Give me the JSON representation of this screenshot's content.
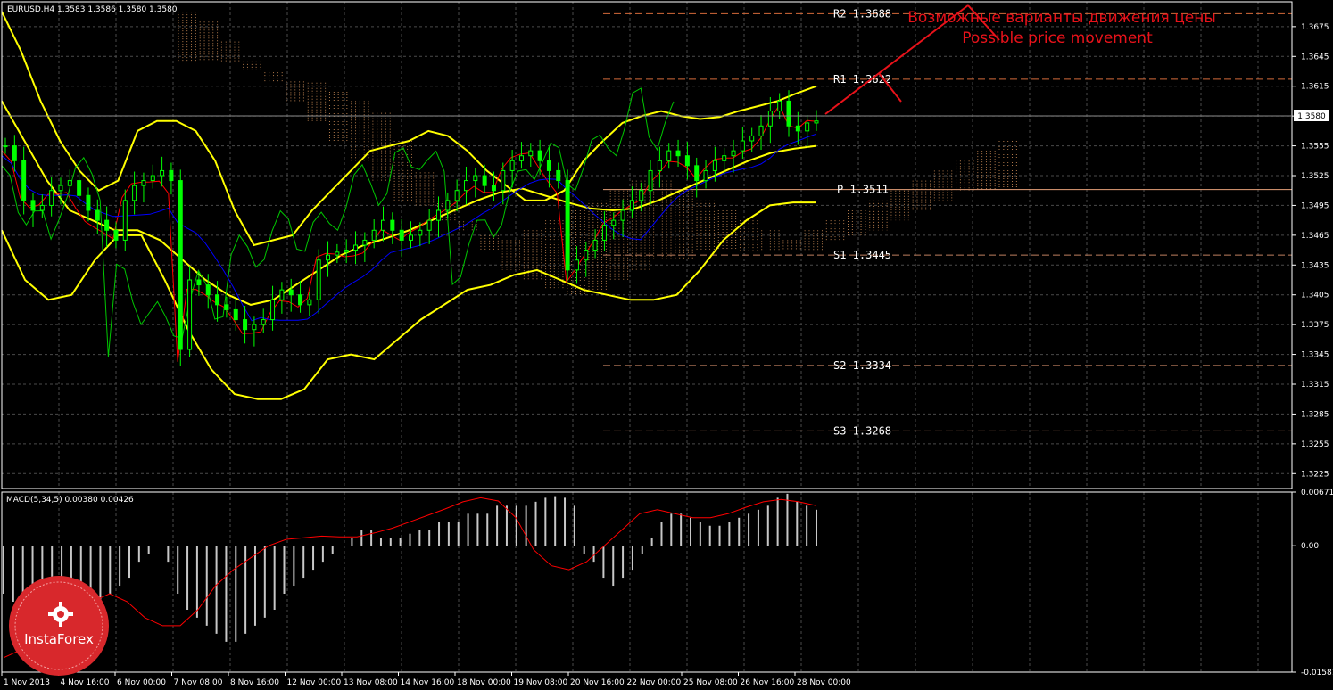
{
  "header": {
    "symbol_line": "EURUSD,H4  1.3583 1.3586 1.3580 1.3580",
    "macd_line": "MACD(5,34,5) 0.00380 0.00426"
  },
  "annotation": {
    "line_ru": "Возможные варианты движения цены",
    "line_en": "Possible price movement"
  },
  "current_price": "1.3580",
  "logo": {
    "text": "InstaForex"
  },
  "colors": {
    "background": "#000000",
    "grid": "#4a4a4a",
    "axis": "#ffffff",
    "candle": "#00ff00",
    "bollinger": "#ffff00",
    "tenkan": "#ff0000",
    "kijun": "#0000ff",
    "chikou": "#00c800",
    "cloud": "#d2915a",
    "pivot_resistance": "#d46a3a",
    "pivot_line": "#e6a07a",
    "support": "#c08060",
    "macd_hist": "#c8c8c8",
    "macd_signal": "#ff0000",
    "annotation": "#e8121a",
    "logo": "#d8282c"
  },
  "chart_data": [
    {
      "type": "candlestick",
      "title": "EURUSD,H4",
      "ylim": [
        1.321,
        1.37
      ],
      "y_ticks": [
        "1.3675",
        "1.3645",
        "1.3615",
        "1.3585",
        "1.3555",
        "1.3525",
        "1.3495",
        "1.3465",
        "1.3435",
        "1.3405",
        "1.3375",
        "1.3345",
        "1.3315",
        "1.3285",
        "1.3255",
        "1.3225"
      ],
      "x_ticks": [
        "1 Nov 2013",
        "4 Nov 16:00",
        "6 Nov 00:00",
        "7 Nov 08:00",
        "8 Nov 16:00",
        "12 Nov 00:00",
        "13 Nov 08:00",
        "14 Nov 16:00",
        "18 Nov 00:00",
        "19 Nov 08:00",
        "20 Nov 16:00",
        "22 Nov 00:00",
        "25 Nov 08:00",
        "26 Nov 16:00",
        "28 Nov 00:00"
      ],
      "levels": [
        {
          "name": "R2",
          "label": "R2  1.3688",
          "value": 1.3688
        },
        {
          "name": "R1",
          "label": "R1  1.3622",
          "value": 1.3622
        },
        {
          "name": "P",
          "label": "P  1.3511",
          "value": 1.3511
        },
        {
          "name": "S1",
          "label": "S1  1.3445",
          "value": 1.3445
        },
        {
          "name": "S2",
          "label": "S2  1.3334",
          "value": 1.3334
        },
        {
          "name": "S3",
          "label": "S3  1.3268",
          "value": 1.3268
        }
      ],
      "close_path": [
        1.3555,
        1.354,
        1.35,
        1.349,
        1.3495,
        1.351,
        1.3515,
        1.352,
        1.3505,
        1.349,
        1.348,
        1.347,
        1.346,
        1.35,
        1.3515,
        1.352,
        1.3525,
        1.353,
        1.352,
        1.335,
        1.342,
        1.3415,
        1.3405,
        1.3395,
        1.339,
        1.338,
        1.337,
        1.3375,
        1.338,
        1.34,
        1.341,
        1.3405,
        1.3395,
        1.34,
        1.344,
        1.3445,
        1.3448,
        1.345,
        1.3455,
        1.346,
        1.347,
        1.348,
        1.347,
        1.346,
        1.3465,
        1.347,
        1.348,
        1.349,
        1.35,
        1.351,
        1.352,
        1.3525,
        1.3515,
        1.351,
        1.353,
        1.354,
        1.3545,
        1.355,
        1.354,
        1.353,
        1.352,
        1.343,
        1.344,
        1.345,
        1.346,
        1.3475,
        1.348,
        1.349,
        1.35,
        1.351,
        1.353,
        1.354,
        1.355,
        1.3545,
        1.3535,
        1.352,
        1.353,
        1.354,
        1.3545,
        1.355,
        1.356,
        1.3565,
        1.3575,
        1.359,
        1.36,
        1.3575,
        1.357,
        1.3578,
        1.358
      ],
      "bollinger_upper": [
        1.369,
        1.365,
        1.36,
        1.356,
        1.353,
        1.351,
        1.352,
        1.357,
        1.358,
        1.358,
        1.357,
        1.354,
        1.349,
        1.3455,
        1.346,
        1.3465,
        1.349,
        1.351,
        1.353,
        1.355,
        1.3555,
        1.356,
        1.357,
        1.3565,
        1.355,
        1.353,
        1.3515,
        1.35,
        1.35,
        1.351,
        1.354,
        1.356,
        1.3578,
        1.3585,
        1.359,
        1.3585,
        1.3582,
        1.3584,
        1.359,
        1.3595,
        1.36,
        1.3608,
        1.3615
      ],
      "bollinger_middle": [
        1.36,
        1.356,
        1.352,
        1.349,
        1.348,
        1.347,
        1.347,
        1.346,
        1.344,
        1.342,
        1.3405,
        1.3395,
        1.34,
        1.3415,
        1.343,
        1.3445,
        1.3455,
        1.3462,
        1.347,
        1.348,
        1.349,
        1.35,
        1.3508,
        1.3512,
        1.3505,
        1.3498,
        1.3492,
        1.349,
        1.3492,
        1.35,
        1.351,
        1.352,
        1.353,
        1.354,
        1.3548,
        1.3552,
        1.3555
      ],
      "bollinger_lower": [
        1.347,
        1.342,
        1.34,
        1.3405,
        1.344,
        1.3465,
        1.3465,
        1.342,
        1.337,
        1.333,
        1.3305,
        1.33,
        1.33,
        1.331,
        1.334,
        1.3345,
        1.334,
        1.336,
        1.338,
        1.3395,
        1.341,
        1.3415,
        1.3425,
        1.343,
        1.342,
        1.341,
        1.3405,
        1.34,
        1.34,
        1.3405,
        1.343,
        1.346,
        1.348,
        1.3495,
        1.3498,
        1.3498
      ],
      "forecast_path": [
        1.358,
        1.362,
        1.36,
        1.3688
      ]
    },
    {
      "type": "bar",
      "title": "MACD(5,34,5)",
      "y_ticks": [
        "0.00671",
        "0.00",
        "-0.01581"
      ],
      "ylim": [
        -0.01581,
        0.00671
      ],
      "values": [
        -0.006,
        -0.007,
        -0.008,
        -0.01,
        -0.012,
        -0.013,
        -0.012,
        -0.011,
        -0.009,
        -0.008,
        -0.007,
        -0.006,
        -0.005,
        -0.004,
        -0.002,
        -0.001,
        0.0,
        -0.002,
        -0.006,
        -0.008,
        -0.009,
        -0.01,
        -0.011,
        -0.012,
        -0.012,
        -0.011,
        -0.01,
        -0.009,
        -0.008,
        -0.006,
        -0.005,
        -0.004,
        -0.003,
        -0.002,
        -0.001,
        0.0,
        0.001,
        0.002,
        0.002,
        0.001,
        0.001,
        0.001,
        0.0015,
        0.002,
        0.002,
        0.003,
        0.003,
        0.003,
        0.004,
        0.004,
        0.004,
        0.005,
        0.005,
        0.005,
        0.005,
        0.0055,
        0.006,
        0.0062,
        0.006,
        0.005,
        -0.001,
        -0.002,
        -0.004,
        -0.005,
        -0.004,
        -0.003,
        -0.001,
        0.001,
        0.003,
        0.004,
        0.004,
        0.0035,
        0.003,
        0.0025,
        0.0025,
        0.003,
        0.0035,
        0.004,
        0.0045,
        0.005,
        0.006,
        0.0065,
        0.0055,
        0.005,
        0.0045
      ],
      "signal": [
        -0.014,
        -0.013,
        -0.012,
        -0.011,
        -0.009,
        -0.007,
        -0.006,
        -0.007,
        -0.009,
        -0.01,
        -0.01,
        -0.008,
        -0.005,
        -0.003,
        -0.0015,
        0.0,
        0.0008,
        0.001,
        0.0012,
        0.0011,
        0.0011,
        0.0016,
        0.0022,
        0.003,
        0.0038,
        0.0046,
        0.0055,
        0.006,
        0.0056,
        0.0035,
        -0.0005,
        -0.0025,
        -0.003,
        -0.002,
        0.0,
        0.002,
        0.004,
        0.0045,
        0.004,
        0.0035,
        0.0035,
        0.004,
        0.0048,
        0.0055,
        0.0058,
        0.0055,
        0.005
      ]
    }
  ]
}
